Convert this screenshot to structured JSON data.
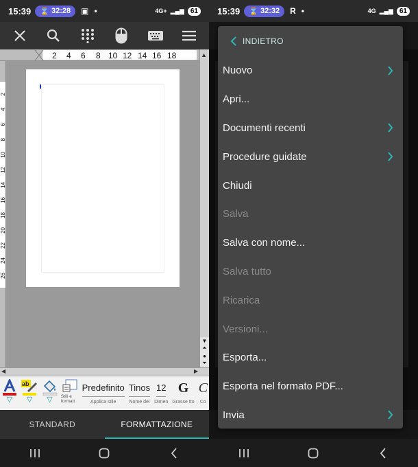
{
  "left": {
    "status": {
      "time": "15:39",
      "timer": "32:28",
      "network": "4G+",
      "battery": "61"
    },
    "ruler_numbers": [
      "2",
      "4",
      "6",
      "8",
      "10",
      "12",
      "14",
      "16",
      "18"
    ],
    "vruler_numbers": [
      "2",
      "4",
      "6",
      "8",
      "10",
      "12",
      "14",
      "16",
      "18",
      "20",
      "22",
      "24",
      "26"
    ],
    "format_bar": {
      "style_small": "Stili e formatt",
      "style_value": "Predefinito",
      "style_label": "Applica stile",
      "font_value": "Tinos",
      "font_label": "Nome del",
      "size_value": "12",
      "size_label": "Dimen",
      "bold_glyph": "G",
      "bold_label": "Grasse tto",
      "italic_glyph": "C",
      "italic_label": "Co"
    },
    "tabs": [
      {
        "label": "STANDARD",
        "active": false
      },
      {
        "label": "FORMATTAZIONE",
        "active": true
      }
    ]
  },
  "right": {
    "status": {
      "time": "15:39",
      "timer": "32:32",
      "extra": "R",
      "network": "4G",
      "battery": "61"
    },
    "menu": {
      "back_label": "INDIETRO",
      "items": [
        {
          "label": "Nuovo",
          "submenu": true,
          "disabled": false
        },
        {
          "label": "Apri...",
          "submenu": false,
          "disabled": false
        },
        {
          "label": "Documenti recenti",
          "submenu": true,
          "disabled": false
        },
        {
          "label": "Procedure guidate",
          "submenu": true,
          "disabled": false
        },
        {
          "label": "Chiudi",
          "submenu": false,
          "disabled": false
        },
        {
          "label": "Salva",
          "submenu": false,
          "disabled": true
        },
        {
          "label": "Salva con nome...",
          "submenu": false,
          "disabled": false
        },
        {
          "label": "Salva tutto",
          "submenu": false,
          "disabled": true
        },
        {
          "label": "Ricarica",
          "submenu": false,
          "disabled": true
        },
        {
          "label": "Versioni...",
          "submenu": false,
          "disabled": true
        },
        {
          "label": "Esporta...",
          "submenu": false,
          "disabled": false
        },
        {
          "label": "Esporta nel formato PDF...",
          "submenu": false,
          "disabled": false
        },
        {
          "label": "Invia",
          "submenu": true,
          "disabled": false
        }
      ]
    }
  },
  "colors": {
    "accent": "#2bb5b5",
    "timer_pill": "#5f5fd6",
    "menu_bg": "#454545"
  }
}
